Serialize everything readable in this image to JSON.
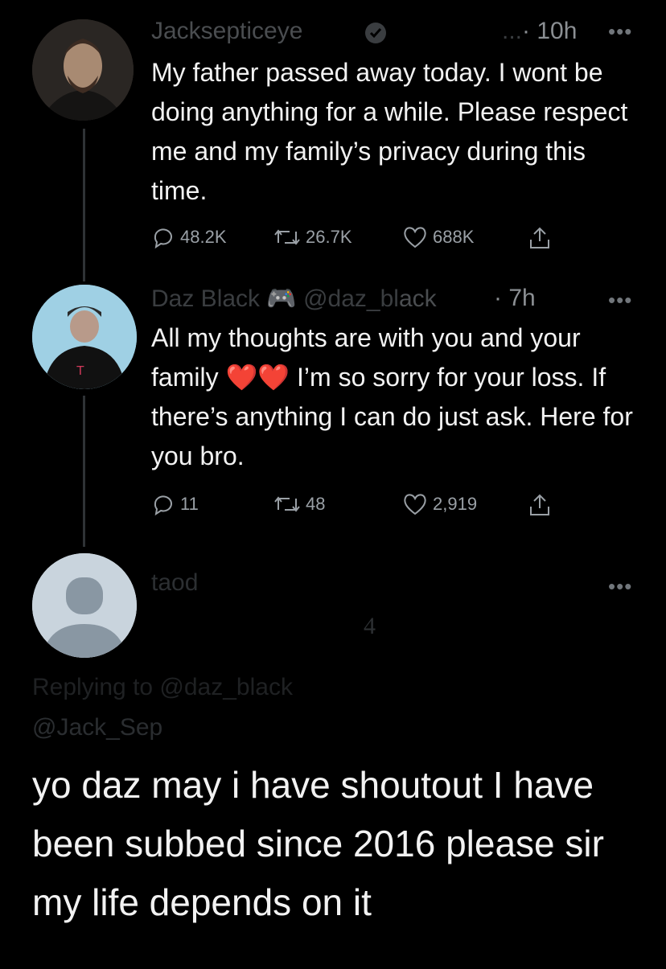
{
  "tweets": [
    {
      "name": "Jacksepticeye",
      "time": "· 10h",
      "text": "My father passed away today. I wont be doing anything for a while. Please respect me and my family’s privacy during this time.",
      "replies": "48.2K",
      "retweets": "26.7K",
      "likes": "688K"
    },
    {
      "name": "daz_black",
      "handle": "@daz_black",
      "time": "· 7h",
      "text_before": "All my thoughts are with you and your family ",
      "text_hearts": "❤️❤️",
      "text_after": " I’m so sorry for your loss. If there’s anything I can do just ask. Here for you bro.",
      "replies": "11",
      "retweets": "48",
      "likes": "2,919"
    }
  ],
  "reply": {
    "name": "taod",
    "partial_digit": "4",
    "replying_to_line1": "Replying to @daz_black",
    "replying_to_line2": "@Jack_Sep",
    "text": "yo daz may i have shoutout I have been subbed since 2016 please sir my life depends on it"
  },
  "icons": [
    "verified-icon",
    "more-icon",
    "reply-icon",
    "retweet-icon",
    "like-icon",
    "share-icon",
    "default-avatar"
  ],
  "colors": {
    "background": "#000000",
    "text": "#f2f2f2",
    "muted": "#9aa0a6",
    "heart": "#e0245e"
  }
}
